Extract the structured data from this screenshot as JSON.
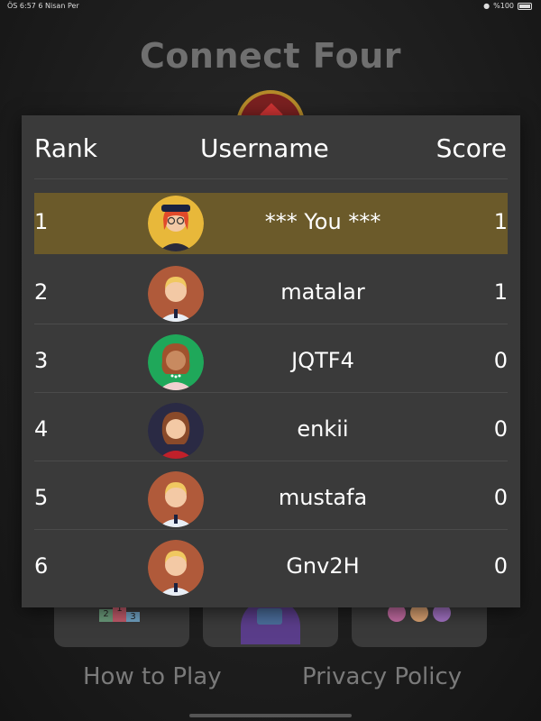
{
  "status_bar": {
    "time_date": "ÖS 6:57   6 Nisan Per",
    "battery": "%100"
  },
  "app": {
    "title": "Connect Four"
  },
  "leaderboard": {
    "headers": {
      "rank": "Rank",
      "username": "Username",
      "score": "Score"
    },
    "rows": [
      {
        "rank": "1",
        "username": "***  You  ***",
        "score": "1",
        "highlight": true,
        "avatar": "avatar-woman-red-hair-glasses-icon"
      },
      {
        "rank": "2",
        "username": "matalar",
        "score": "1",
        "highlight": false,
        "avatar": "avatar-man-blond-icon"
      },
      {
        "rank": "3",
        "username": "JQTF4",
        "score": "0",
        "highlight": false,
        "avatar": "avatar-woman-curly-hair-icon"
      },
      {
        "rank": "4",
        "username": "enkii",
        "score": "0",
        "highlight": false,
        "avatar": "avatar-woman-brown-hair-icon"
      },
      {
        "rank": "5",
        "username": "mustafa",
        "score": "0",
        "highlight": false,
        "avatar": "avatar-man-blond-icon"
      },
      {
        "rank": "6",
        "username": "Gnv2H",
        "score": "0",
        "highlight": false,
        "avatar": "avatar-man-blond-icon"
      }
    ]
  },
  "menu_cards": [
    {
      "name": "leaderboard-podium-icon",
      "podium": [
        "2",
        "1",
        "3"
      ]
    },
    {
      "name": "guide-tablet-icon"
    },
    {
      "name": "people-group-icon"
    }
  ],
  "bottom_links": {
    "how_to_play": "How to Play",
    "privacy_policy": "Privacy Policy"
  },
  "colors": {
    "highlight_row": "#6b5a2a",
    "overlay_bg": "#3a3a3a",
    "title_gray": "#6f6f6f"
  }
}
